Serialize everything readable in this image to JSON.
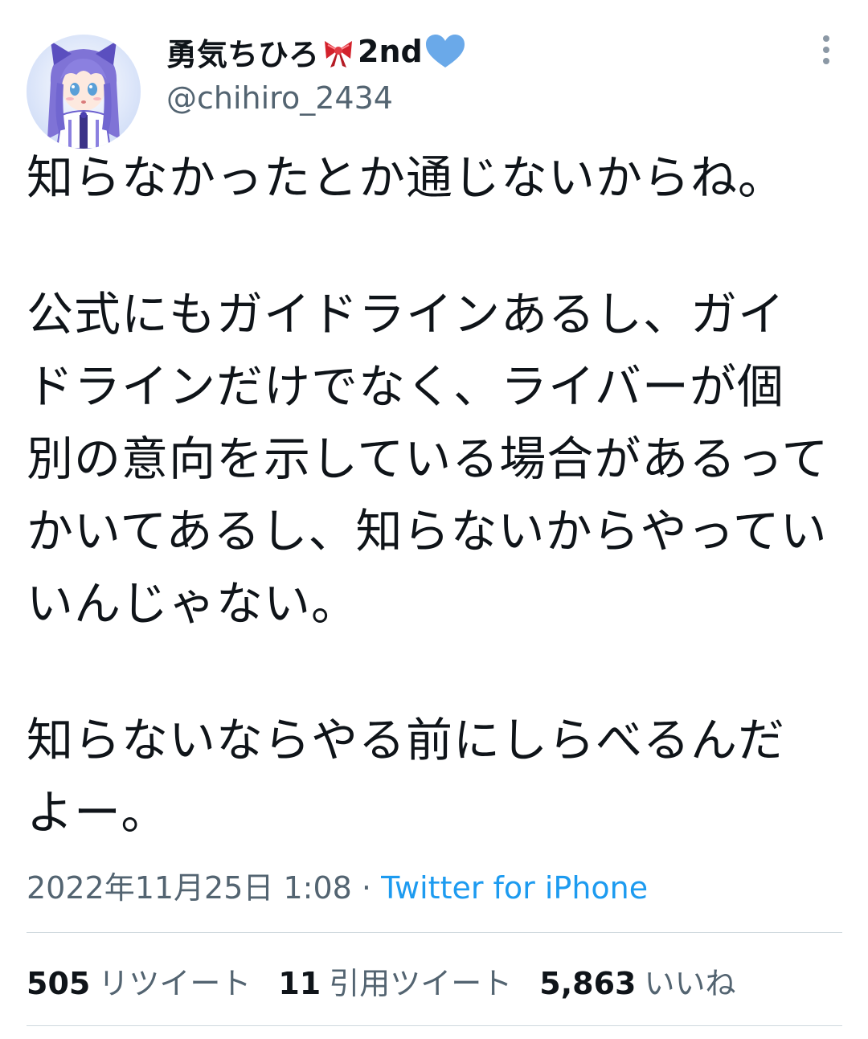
{
  "user": {
    "display_name": "勇気ちひろ",
    "display_name_suffix": "2nd",
    "name_emojis": [
      "ribbon-emoji",
      "blue-heart-emoji"
    ],
    "handle": "@chihiro_2434",
    "avatar": "avatar-image"
  },
  "tweet": {
    "lines": [
      "知らなかったとか通じないからね。",
      "",
      "公式にもガイドラインあるし、ガイ",
      "ドラインだけでなく、ライバーが個",
      "別の意向を示している場合があるって",
      "かいてあるし、知らないからやってい",
      "いんじゃない。",
      "",
      "知らないならやる前にしらべるんだ",
      "よー。"
    ]
  },
  "meta": {
    "datetime": "2022年11月25日 1:08",
    "separator": "·",
    "source": "Twitter for iPhone"
  },
  "stats": {
    "retweets_count": "505",
    "retweets_label": "リツイート",
    "quotes_count": "11",
    "quotes_label": "引用ツイート",
    "likes_count": "5,863",
    "likes_label": "いいね"
  },
  "colors": {
    "text": "#0f1419",
    "secondary": "#536471",
    "link": "#1d9bf0",
    "divider": "#cfd9de",
    "ribbon": "#d3222c",
    "heart": "#6aa9e9"
  },
  "icons": {
    "more": "more-vertical-icon"
  }
}
